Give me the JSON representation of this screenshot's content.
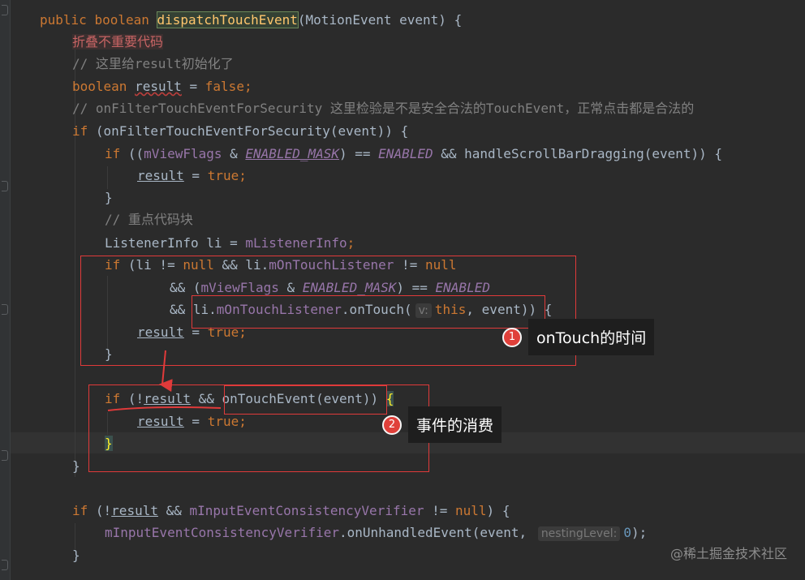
{
  "editor": {
    "lines": {
      "l0": {
        "public": "public",
        "boolean": "boolean",
        "method": "dispatchTouchEvent",
        "params": "(MotionEvent event) {"
      },
      "l1": {
        "folded": "折叠不重要代码"
      },
      "l2": {
        "comment": "// 这里给result初始化了"
      },
      "l3": {
        "boolean": "boolean",
        "var": "result",
        "assign": " = ",
        "false": "false",
        "semi": ";"
      },
      "l4": {
        "comment": "// onFilterTouchEventForSecurity 这里检验是不是安全合法的TouchEvent，正常点击都是合法的"
      },
      "l5": {
        "if": "if",
        "rest": " (onFilterTouchEventForSecurity(event)) {"
      },
      "l6": {
        "if": "if",
        "p1": " ((",
        "mViewFlags": "mViewFlags",
        "amp": " & ",
        "mask": "ENABLED_MASK",
        "eq": ") == ",
        "enabled": "ENABLED",
        "rest": " && handleScrollBarDragging(event)) {"
      },
      "l7": {
        "var": "result",
        "assign": " = ",
        "true": "true",
        "semi": ";"
      },
      "l8": {
        "brace": "}"
      },
      "l9": {
        "comment": "// 重点代码块"
      },
      "l10": {
        "type": "ListenerInfo li = ",
        "field": "mListenerInfo",
        "semi": ";"
      },
      "l11": {
        "if": "if",
        "p1": " (li != ",
        "null1": "null",
        "p2": " && li.",
        "field": "mOnTouchListener",
        "p3": " != ",
        "null2": "null"
      },
      "l12": {
        "p1": "&& (",
        "mViewFlags": "mViewFlags",
        "amp": " & ",
        "mask": "ENABLED_MASK",
        "eq": ") == ",
        "enabled": "ENABLED"
      },
      "l13": {
        "p1": "&& li.",
        "field": "mOnTouchListener",
        "p2": ".onTouch(",
        "hint": "v:",
        "this": "this",
        "p3": ", event)) {"
      },
      "l14": {
        "var": "result",
        "assign": " = ",
        "true": "true",
        "semi": ";"
      },
      "l15": {
        "brace": "}"
      },
      "l16": {
        "if": "if",
        "p1": " (!",
        "var": "result",
        "p2": " && ",
        "call": "onTouchEvent(event))",
        "brace": "{"
      },
      "l17": {
        "var": "result",
        "assign": " = ",
        "true": "true",
        "semi": ";"
      },
      "l18": {
        "brace": "}"
      },
      "l19": {
        "brace": "}"
      },
      "l20": {
        "if": "if",
        "p1": " (!",
        "var": "result",
        "p2": " && ",
        "field": "mInputEventConsistencyVerifier",
        "p3": " != ",
        "null": "null",
        "p4": ") {"
      },
      "l21": {
        "field": "mInputEventConsistencyVerifier",
        "p1": ".onUnhandledEvent(event, ",
        "hint": "nestingLevel:",
        "num": "0",
        "p2": ");"
      },
      "l22": {
        "brace": "}"
      }
    }
  },
  "annotations": {
    "callout1": {
      "number": "1",
      "label": "onTouch的时间"
    },
    "callout2": {
      "number": "2",
      "label": "事件的消费"
    }
  },
  "colors": {
    "background": "#2b2b2b",
    "keyword": "#cc7832",
    "field": "#9876aa",
    "comment": "#808080",
    "method_highlight": "#ffc66d",
    "annotation_red": "#e03a3a"
  },
  "watermark": "@稀土掘金技术社区"
}
